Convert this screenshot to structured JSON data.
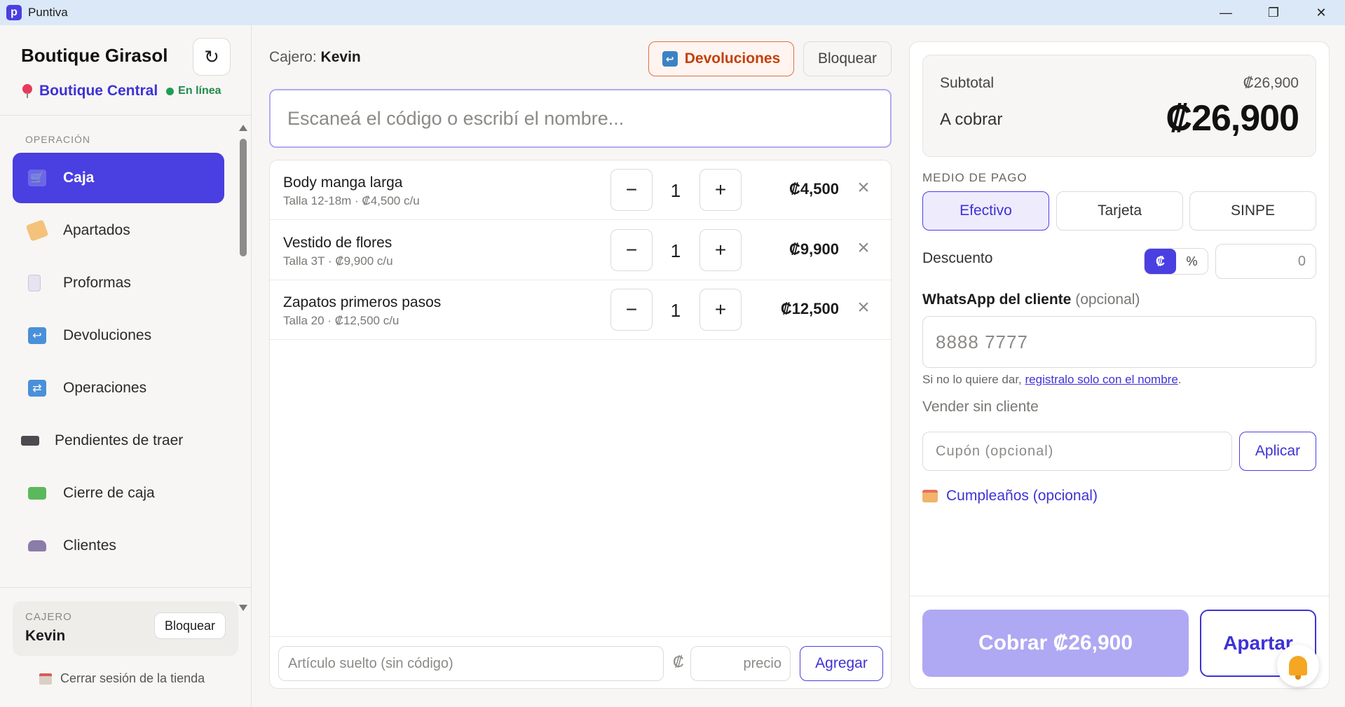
{
  "window": {
    "title": "Puntiva",
    "logo_letter": "p"
  },
  "sidebar": {
    "store_name": "Boutique Girasol",
    "refresh_symbol": "↻",
    "branch": "Boutique Central",
    "status": "En línea",
    "section_label": "OPERACIÓN",
    "items": [
      {
        "label": "Caja",
        "icon": "cart-icon",
        "active": true
      },
      {
        "label": "Apartados",
        "icon": "tag-icon"
      },
      {
        "label": "Proformas",
        "icon": "receipt-icon"
      },
      {
        "label": "Devoluciones",
        "icon": "return-icon"
      },
      {
        "label": "Operaciones",
        "icon": "repeat-icon"
      },
      {
        "label": "Pendientes de traer",
        "icon": "truck-icon"
      },
      {
        "label": "Cierre de caja",
        "icon": "cash-icon"
      },
      {
        "label": "Clientes",
        "icon": "people-icon"
      }
    ],
    "cashier_label": "CAJERO",
    "cashier_name": "Kevin",
    "lock_label": "Bloquear",
    "logout_label": "Cerrar sesión de la tienda"
  },
  "main": {
    "cashier_prefix": "Cajero:",
    "cashier_name": "Kevin",
    "returns_label": "Devoluciones",
    "lock_label": "Bloquear",
    "search_placeholder": "Escaneá el código o escribí el nombre...",
    "cart": [
      {
        "name": "Body manga larga",
        "detail": "Talla 12-18m · ₡4,500 c/u",
        "qty": "1",
        "total": "₡4,500"
      },
      {
        "name": "Vestido de flores",
        "detail": "Talla 3T · ₡9,900 c/u",
        "qty": "1",
        "total": "₡9,900"
      },
      {
        "name": "Zapatos primeros pasos",
        "detail": "Talla 20 · ₡12,500 c/u",
        "qty": "1",
        "total": "₡12,500"
      }
    ],
    "loose_placeholder": "Artículo suelto (sin código)",
    "currency_symbol": "₡",
    "price_placeholder": "precio",
    "add_label": "Agregar"
  },
  "checkout": {
    "subtotal_label": "Subtotal",
    "subtotal_value": "₡26,900",
    "charge_label": "A cobrar",
    "charge_value": "₡26,900",
    "payment_label": "MEDIO DE PAGO",
    "payment_options": [
      "Efectivo",
      "Tarjeta",
      "SINPE"
    ],
    "payment_selected": "Efectivo",
    "discount_label": "Descuento",
    "discount_modes": [
      "₡",
      "%"
    ],
    "discount_placeholder": "0",
    "whatsapp_label": "WhatsApp del cliente",
    "whatsapp_optional": "(opcional)",
    "whatsapp_placeholder": "8888 7777",
    "hint_prefix": "Si no lo quiere dar,",
    "hint_link": "registralo solo con el nombre",
    "hint_suffix": ".",
    "no_client_label": "Vender sin cliente",
    "coupon_placeholder": "Cupón (opcional)",
    "apply_label": "Aplicar",
    "birthday_label": "Cumpleaños (opcional)",
    "charge_button": "Cobrar ₡26,900",
    "reserve_button": "Apartar"
  },
  "colors": {
    "accent": "#4a3fe0",
    "returns": "#c2410c",
    "online": "#1f9d55"
  }
}
